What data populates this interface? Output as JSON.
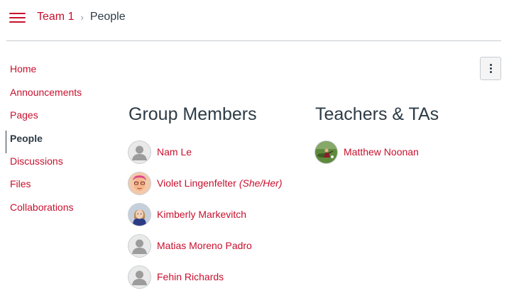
{
  "breadcrumb": {
    "course": "Team 1",
    "separator": "›",
    "current": "People"
  },
  "sidebar": {
    "items": [
      {
        "label": "Home"
      },
      {
        "label": "Announcements"
      },
      {
        "label": "Pages"
      },
      {
        "label": "People"
      },
      {
        "label": "Discussions"
      },
      {
        "label": "Files"
      },
      {
        "label": "Collaborations"
      }
    ],
    "active": "People"
  },
  "group_members": {
    "heading": "Group Members",
    "people": [
      {
        "name": "Nam Le",
        "avatar": "default-avatar-icon"
      },
      {
        "name": "Violet Lingenfelter",
        "pronouns": "(She/Her)",
        "avatar": "cartoon-face-avatar"
      },
      {
        "name": "Kimberly Markevitch",
        "avatar": "photo-avatar"
      },
      {
        "name": "Matias Moreno Padro",
        "avatar": "default-avatar-icon"
      },
      {
        "name": "Fehin Richards",
        "avatar": "default-avatar-icon"
      }
    ]
  },
  "teachers": {
    "heading": "Teachers & TAs",
    "people": [
      {
        "name": "Matthew Noonan",
        "avatar": "photo-avatar"
      }
    ]
  },
  "colors": {
    "accent": "#c8102e",
    "text": "#2d3b45",
    "border": "#c7cdd1"
  }
}
